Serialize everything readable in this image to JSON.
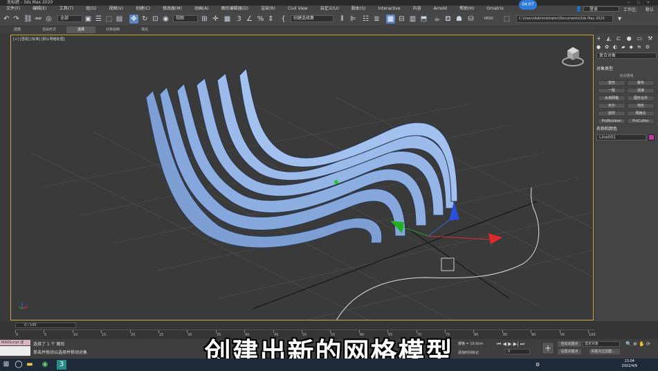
{
  "window": {
    "title": "无标题 - 3ds Max 2020"
  },
  "menu": [
    "文件(F)",
    "编辑(E)",
    "工具(T)",
    "组(G)",
    "视图(V)",
    "创建(C)",
    "修改器(M)",
    "动画(A)",
    "图形编辑器(D)",
    "渲染(R)",
    "Civil View",
    "自定义(U)",
    "脚本(S)",
    "Interactive",
    "内容",
    "Arnold",
    "帮助(H)",
    "Ornatrix"
  ],
  "menu_right": {
    "login": "登录",
    "workspace_label": "工作区:",
    "workspace_value": "默认"
  },
  "clock_bubble": "04:07",
  "toolbar": {
    "selection_filter": "全部",
    "reference_coord": "视图",
    "named_selection": "创建选择集",
    "num_label": "3",
    "zoom_label": "VRS0",
    "path": "C:\\Users\\Administrator\\Documents\\3ds Max 2020"
  },
  "ribbon_tabs": [
    "建模",
    "自由形式",
    "选择",
    "对象绘制",
    "填充"
  ],
  "ribbon_active": 2,
  "viewport": {
    "label": "[+] [透视] [标准] [默认明暗处理]"
  },
  "command_panel": {
    "dropdown": "复合对象",
    "section_object_type": "对象类型",
    "auto_grid": "自动栅格",
    "buttons": [
      [
        "变形",
        "散布"
      ],
      [
        "一致",
        "连接"
      ],
      [
        "水滴网格",
        "图形合并"
      ],
      [
        "布尔",
        "ProBoolean"
      ],
      [
        "地形",
        "放样"
      ],
      [
        "网格化",
        "ProBoolean"
      ],
      [
        "ProCutter",
        "布尔"
      ]
    ],
    "buttons_fixed": [
      [
        "变形",
        "散布"
      ],
      [
        "一致",
        "连接"
      ],
      [
        "水滴网格",
        "图形合并"
      ],
      [
        "布尔",
        "地形"
      ],
      [
        "放样",
        "网格化"
      ],
      [
        "ProBoolean",
        "ProCutter"
      ],
      [
        "ProCutter",
        "布尔"
      ]
    ],
    "section_name_color": "名称和颜色",
    "object_name": "Line001",
    "object_color": "#c03aa0"
  },
  "timeline": {
    "frame_display": "0 / 100",
    "ticks": [
      "0",
      "5",
      "10",
      "15",
      "20",
      "25",
      "30",
      "35",
      "40",
      "45",
      "50",
      "55",
      "60",
      "65",
      "70",
      "75",
      "80",
      "85",
      "90",
      "95",
      "100"
    ]
  },
  "status": {
    "maxscript": "MAXScript 迷",
    "line1": "选择了 1 个 图形",
    "line2": "单击并拖动以选择并移动对象",
    "grid": "栅格 = 10.0cm",
    "add_time_tag": "添加时间标记",
    "frame_value": "0",
    "auto_key": "自动关键点",
    "set_key": "设置关键点",
    "selected_object": "选定对象",
    "key_filters": "关键点过滤器..."
  },
  "subtitle": "创建出新的网格模型",
  "taskbar": {
    "time": "13:04",
    "date": "2022/4/9"
  }
}
